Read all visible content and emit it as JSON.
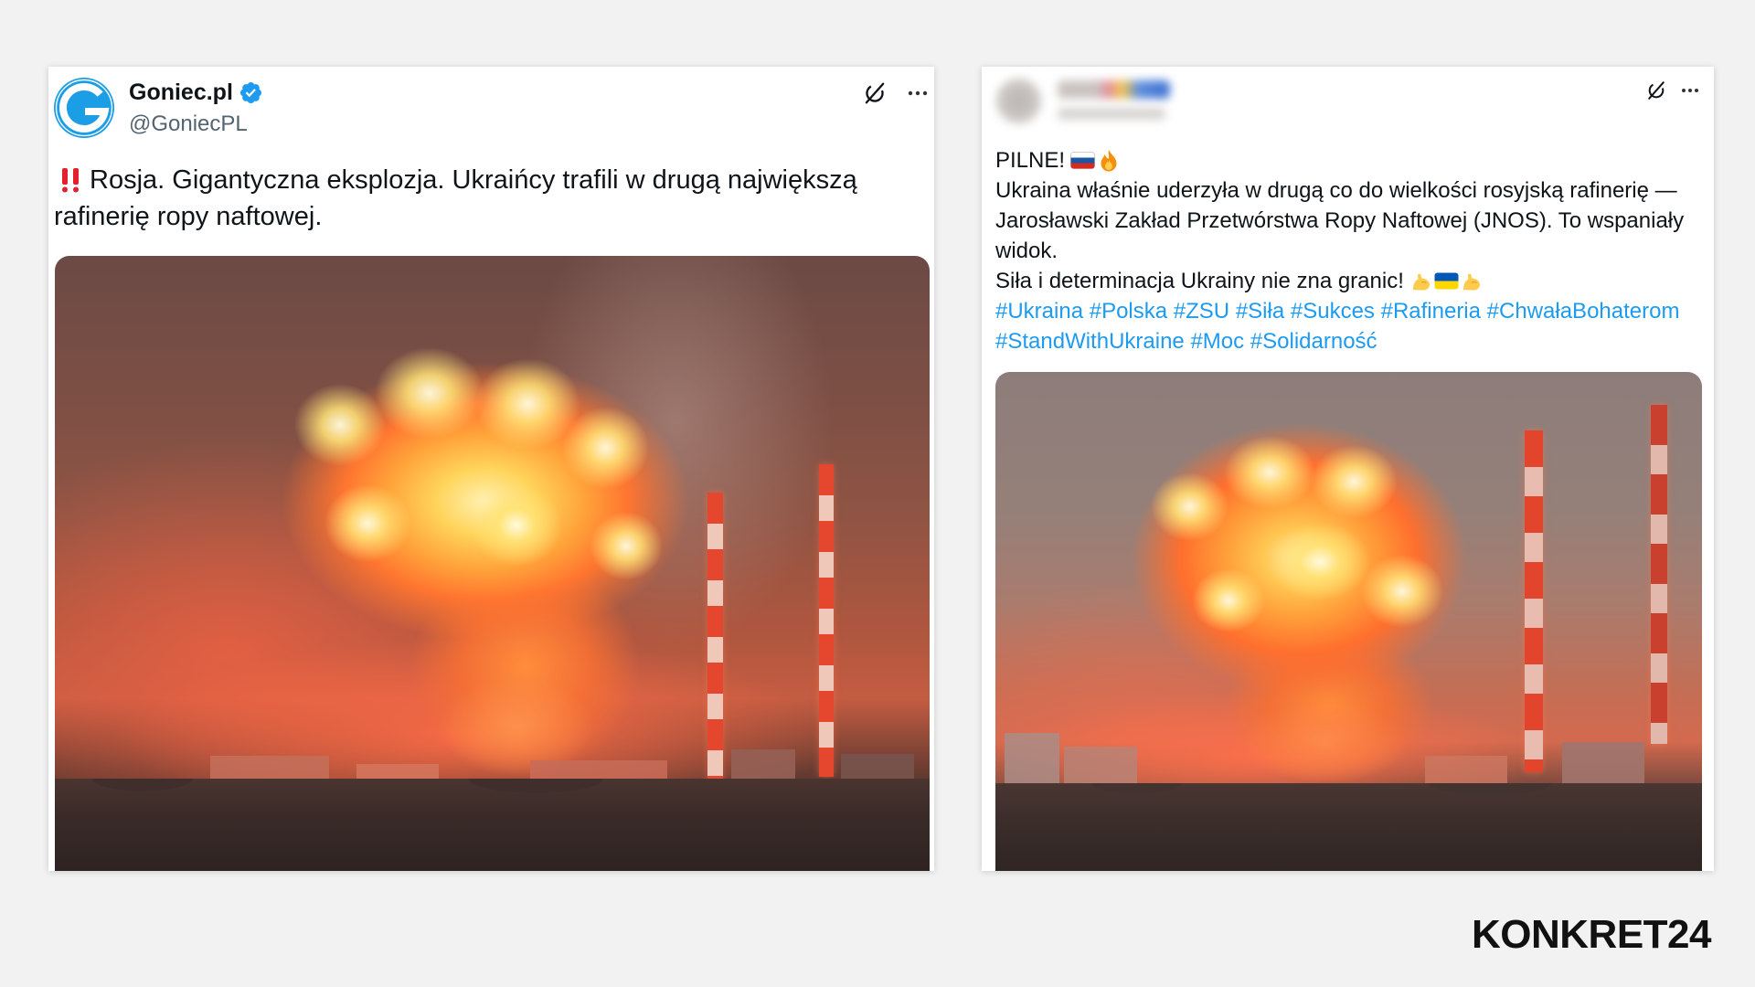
{
  "colors": {
    "page_background": "#f2f2f2",
    "text": "#0f1419",
    "secondary_text": "#536471",
    "link": "#1d9bf0",
    "verified_badge": "#1d9bf0",
    "goniec_logo": "#1b9ee6"
  },
  "left_post": {
    "author": {
      "name": "Goniec.pl",
      "handle": "@GoniecPL",
      "avatar_icon": "goniec-logo-icon",
      "badge_icon": "verified-badge-icon"
    },
    "header_icons": [
      "grok-icon",
      "more-icon"
    ],
    "text": {
      "leading_icon": "double-exclamation-icon",
      "lines": [
        "Rosja. Gigantyczna eksplozja. Ukraińcy trafili w drugą największą",
        "rafinerię ropy naftowej."
      ]
    }
  },
  "right_post": {
    "header_icons": [
      "grok-icon",
      "more-icon"
    ],
    "text": {
      "heading": "PILNE!",
      "heading_icons": [
        "flag-russia-icon",
        "fire-icon"
      ],
      "lines": [
        "Ukraina właśnie uderzyła w drugą co do wielkości rosyjską rafinerię —",
        "Jarosławski Zakład Przetwórstwa Ropy Naftowej (JNOS). To wspaniały",
        "widok."
      ],
      "closing": "Siła i determinacja Ukrainy nie zna granic!",
      "closing_icons": [
        "flexed-biceps-icon",
        "flag-ukraine-icon",
        "flexed-biceps-icon"
      ],
      "hashtag_lines": [
        [
          "#Ukraina",
          "#Polska",
          "#ZSU",
          "#Siła",
          "#Sukces",
          "#Rafineria",
          "#ChwałaBohaterom"
        ],
        [
          "#StandWithUkraine",
          "#Moc",
          "#Solidarność"
        ]
      ]
    }
  },
  "brand": {
    "logo_text": "KONKRET24"
  }
}
